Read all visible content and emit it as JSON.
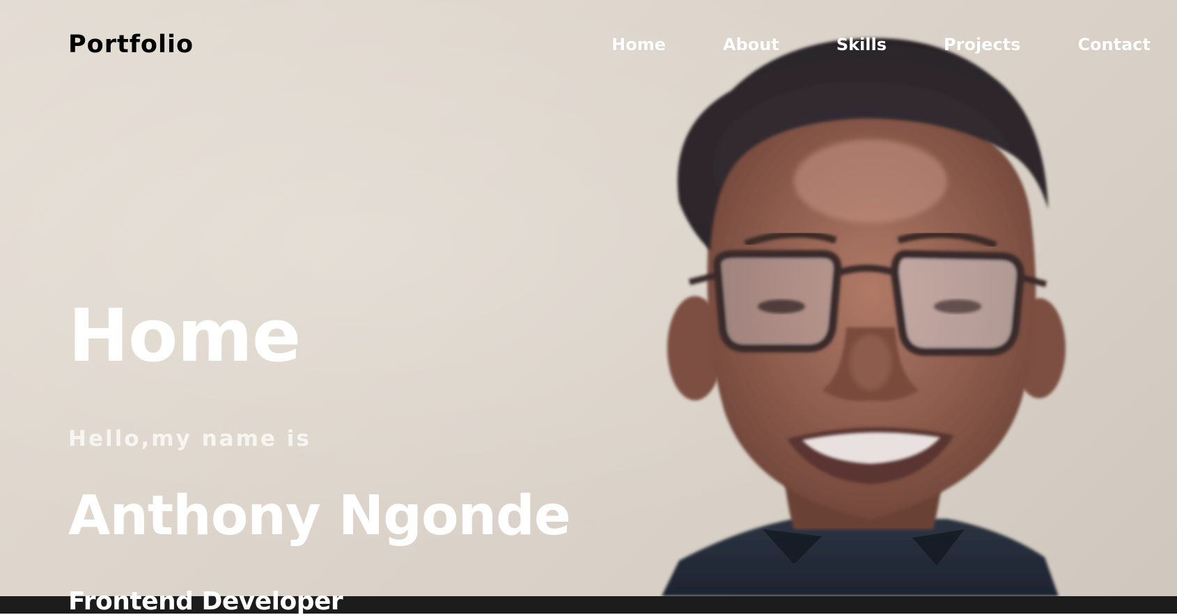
{
  "header": {
    "logo_text": "Portfolio",
    "nav": [
      {
        "label": "Home"
      },
      {
        "label": "About"
      },
      {
        "label": "Skills"
      },
      {
        "label": "Projects"
      },
      {
        "label": "Contact"
      }
    ]
  },
  "hero": {
    "heading": "Home",
    "greeting": "Hello,my name is",
    "name": "Anthony Ngonde",
    "role": "Frontend Developer",
    "photo_icon": "portrait-photo"
  },
  "colors": {
    "background": "#ddd5cb",
    "text_light": "#ffffff",
    "logo": "#000000",
    "footer_bar": "#1c1c1c"
  }
}
